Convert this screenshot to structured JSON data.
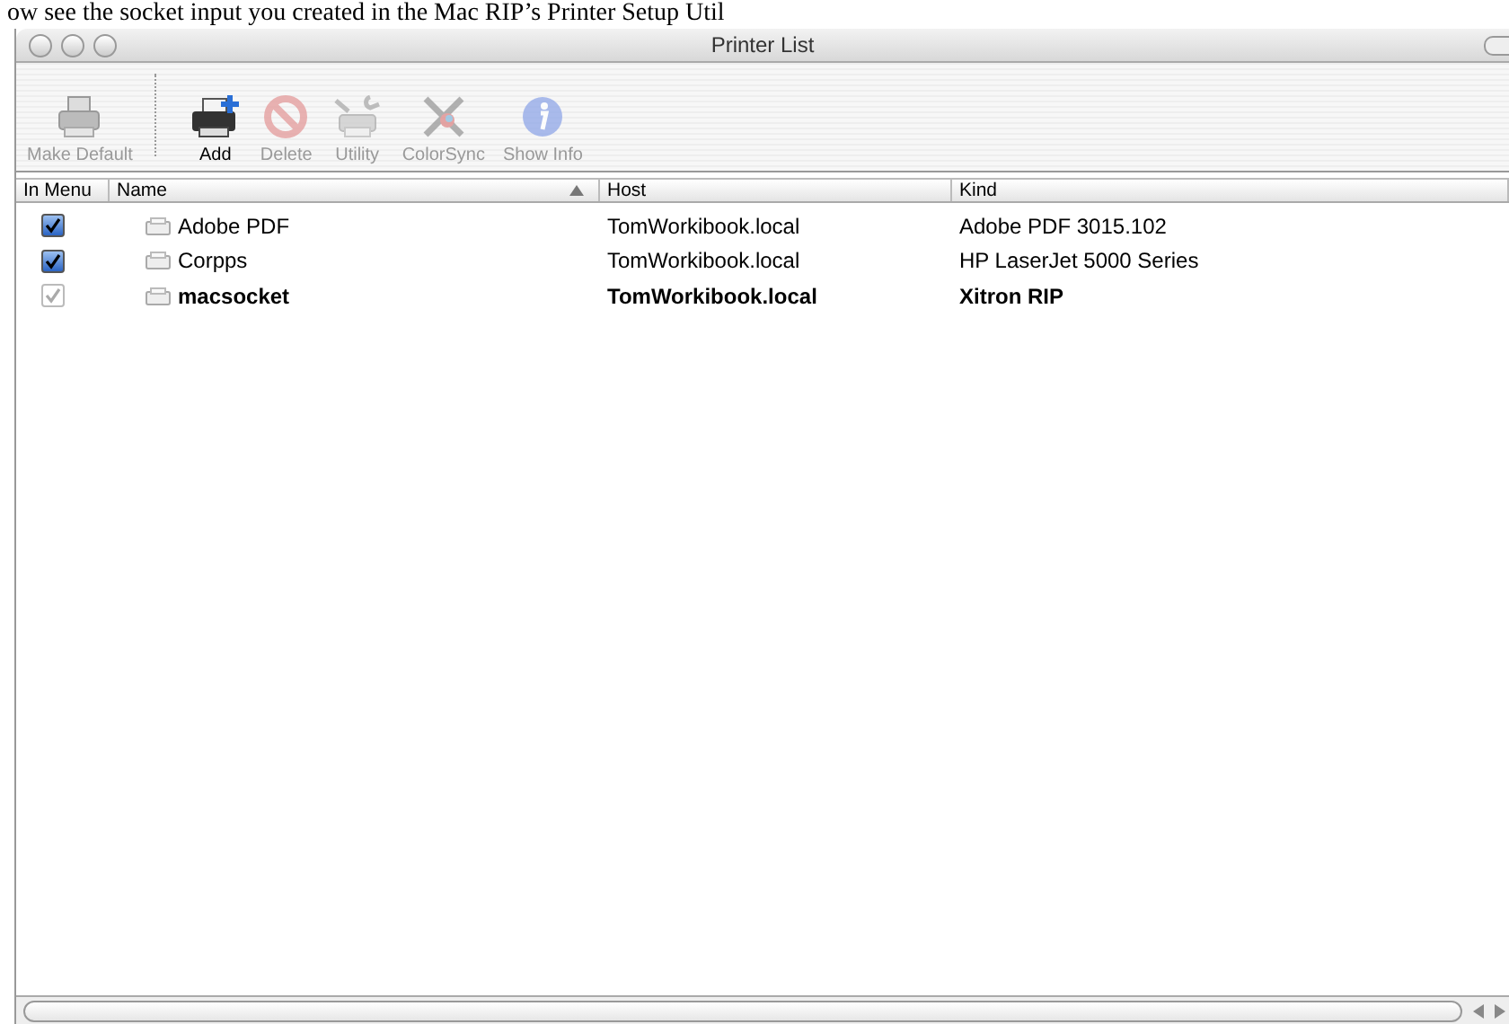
{
  "caption": "ow see the socket input you created in the Mac RIP’s Printer Setup Util",
  "window": {
    "title": "Printer List"
  },
  "toolbar": [
    {
      "kind": "printer",
      "label": "Make Default",
      "disabled": true
    },
    {
      "kind": "add",
      "label": "Add",
      "disabled": false
    },
    {
      "kind": "delete",
      "label": "Delete",
      "disabled": true
    },
    {
      "kind": "utility",
      "label": "Utility",
      "disabled": true
    },
    {
      "kind": "colorsync",
      "label": "ColorSync",
      "disabled": true
    },
    {
      "kind": "info",
      "label": "Show Info",
      "disabled": true
    }
  ],
  "table": {
    "columns": [
      {
        "label": "In Menu",
        "sorted": false
      },
      {
        "label": "Name",
        "sorted": true
      },
      {
        "label": "Host",
        "sorted": false
      },
      {
        "label": "Kind",
        "sorted": false
      }
    ],
    "rows": [
      {
        "in_menu": true,
        "disabled": false,
        "default": false,
        "name": "Adobe PDF",
        "host": "TomWorkibook.local",
        "kind": "Adobe PDF 3015.102"
      },
      {
        "in_menu": true,
        "disabled": false,
        "default": false,
        "name": "Corpps",
        "host": "TomWorkibook.local",
        "kind": "HP LaserJet 5000 Series"
      },
      {
        "in_menu": true,
        "disabled": true,
        "default": true,
        "name": "macsocket",
        "host": "TomWorkibook.local",
        "kind": "Xitron RIP"
      }
    ]
  }
}
